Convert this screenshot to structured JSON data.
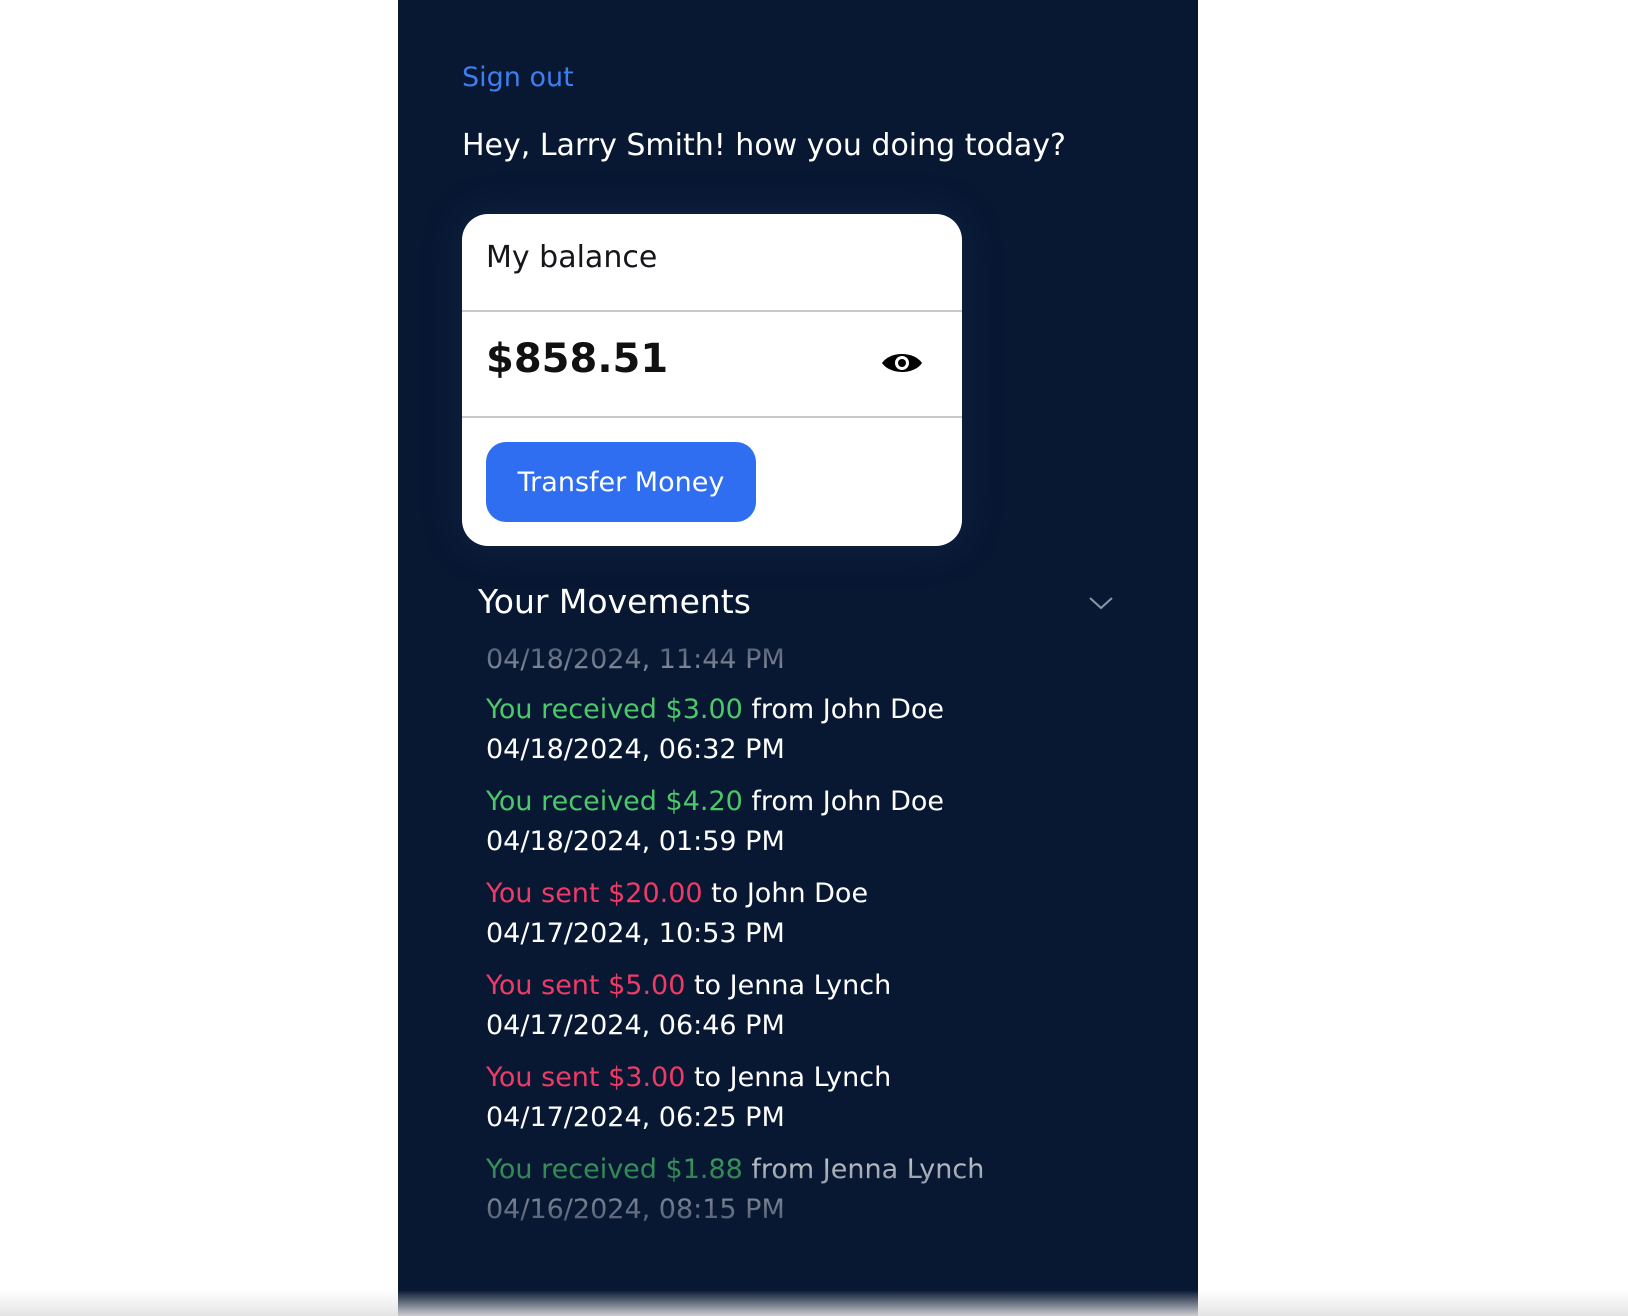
{
  "nav": {
    "sign_out_label": "Sign out"
  },
  "greeting": "Hey, Larry Smith! how you doing today?",
  "balance_card": {
    "title": "My balance",
    "amount": "$858.51",
    "visibility_icon": "eye-icon",
    "transfer_label": "Transfer Money"
  },
  "movements": {
    "title": "Your Movements",
    "toggle_icon": "chevron-down-icon",
    "first_date": "04/18/2024, 11:44 PM",
    "items": [
      {
        "prefix": "You received ",
        "amount": "$3.00",
        "rest": " from John Doe",
        "date": "04/18/2024, 06:32 PM",
        "type": "received"
      },
      {
        "prefix": "You received ",
        "amount": "$4.20",
        "rest": " from John Doe",
        "date": "04/18/2024, 01:59 PM",
        "type": "received"
      },
      {
        "prefix": "You sent ",
        "amount": "$20.00",
        "rest": " to John Doe",
        "date": "04/17/2024, 10:53 PM",
        "type": "sent"
      },
      {
        "prefix": "You sent ",
        "amount": "$5.00",
        "rest": " to Jenna Lynch",
        "date": "04/17/2024, 06:46 PM",
        "type": "sent"
      },
      {
        "prefix": "You sent ",
        "amount": "$3.00",
        "rest": " to Jenna Lynch",
        "date": "04/17/2024, 06:25 PM",
        "type": "sent"
      },
      {
        "prefix": "You received ",
        "amount": "$1.88",
        "rest": " from Jenna Lynch",
        "date": "04/16/2024, 08:15 PM",
        "type": "received"
      }
    ]
  },
  "colors": {
    "background": "#081833",
    "link": "#3d7ef0",
    "button": "#2f6ef0",
    "received": "#4cc76a",
    "sent": "#ee3a66"
  }
}
